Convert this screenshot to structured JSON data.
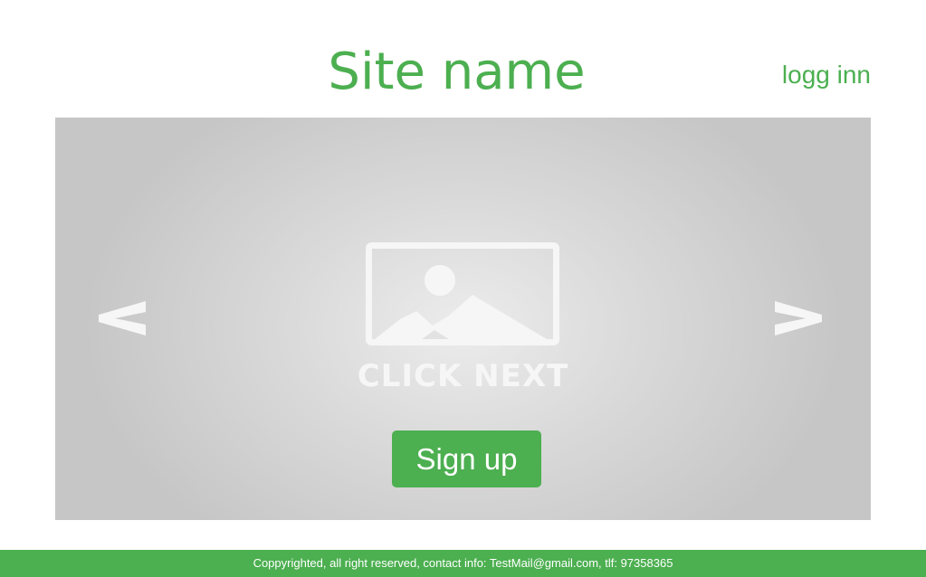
{
  "header": {
    "site_name": "Site name",
    "login_label": "logg inn"
  },
  "slider": {
    "prev_label": "<",
    "next_label": ">",
    "placeholder_text": "CLICK NEXT",
    "placeholder_icon": "image-placeholder-icon",
    "signup_label": "Sign up"
  },
  "footer": {
    "text": "Coppyrighted, all right reserved, contact info: TestMail@gmail.com, tlf: 97358365"
  },
  "colors": {
    "accent": "#4caf50",
    "slider_bg": "#c6c6c6",
    "placeholder_fg": "#f6f6f6"
  }
}
